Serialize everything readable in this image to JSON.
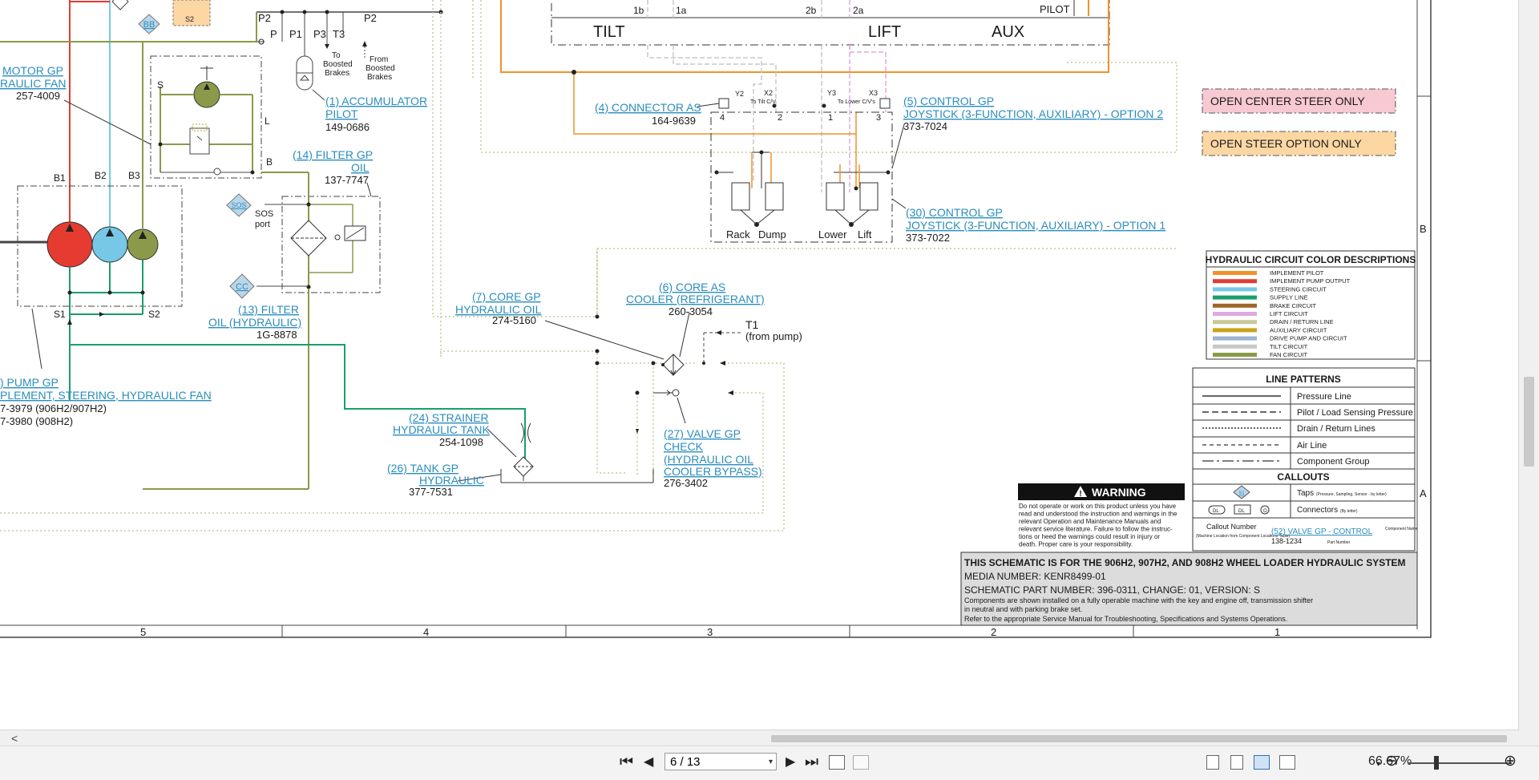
{
  "viewer": {
    "page_current": "6 / 13",
    "zoom": "66.67%",
    "zoom_out": "⊖",
    "zoom_in": "⊕",
    "hscroll_left": "<",
    "dropdown": "▾",
    "nav": {
      "first": "⏮",
      "prev": "◀",
      "next": "▶",
      "last": "⏭"
    }
  },
  "schematic": {
    "top_labels": {
      "p2a": "P2",
      "p": "P",
      "p1": "P1",
      "p3": "P3",
      "t3": "T3",
      "p2b": "P2",
      "bb": "BB",
      "s2box": "S2",
      "to_boosted": "To Boosted Brakes",
      "from_boosted": "From Boosted Brakes",
      "n1b": "1b",
      "n1a": "1a",
      "n2b": "2b",
      "n2a": "2a",
      "tilt": "TILT",
      "lift": "LIFT",
      "aux": "AUX",
      "pilot": "PILOT"
    },
    "callouts": {
      "motor_l1": "MOTOR GP",
      "motor_l2": "RAULIC FAN",
      "motor_pn": "257-4009",
      "acc_l1": "(1) ACCUMULATOR",
      "acc_l2": "PILOT",
      "acc_pn": "149-0686",
      "conn4_l1": "(4) CONNECTOR AS",
      "conn4_pn": "164-9639",
      "c5_l1": "(5) CONTROL GP",
      "c5_l2": "JOYSTICK (3-FUNCTION, AUXILIARY) - OPTION 2",
      "c5_pn": "373-7024",
      "c30_l1": "(30) CONTROL GP",
      "c30_l2": "JOYSTICK (3-FUNCTION, AUXILIARY) - OPTION 1",
      "c30_pn": "373-7022",
      "f14_l1": "(14) FILTER GP",
      "f14_l2": "OIL",
      "f14_pn": "137-7747",
      "f13_l1": "(13) FILTER",
      "f13_l2": "OIL (HYDRAULIC)",
      "f13_pn": "1G-8878",
      "c7_l1": "(7) CORE GP",
      "c7_l2": "HYDRAULIC OIL",
      "c7_pn": "274-5160",
      "c6_l1": "(6) CORE AS",
      "c6_l2": "COOLER (REFRIGERANT)",
      "c6_pn": "260-3054",
      "t1_l1": "T1",
      "t1_l2": "(from pump)",
      "pump_l1": ") PUMP GP",
      "pump_l2": "PLEMENT, STEERING, HYDRAULIC FAN",
      "pump_pn1": "7-3979 (906H2/907H2)",
      "pump_pn2": "7-3980 (908H2)",
      "s24_l1": "(24) STRAINER",
      "s24_l2": "HYDRAULIC TANK",
      "s24_pn": "254-1098",
      "t26_l1": "(26) TANK GP",
      "t26_l2": "HYDRAULIC",
      "t26_pn": "377-7531",
      "v27_l1": "(27) VALVE GP",
      "v27_l2": "CHECK",
      "v27_l3": "(HYDRAULIC OIL",
      "v27_l4": "COOLER BYPASS)",
      "v27_pn": "276-3402"
    },
    "small_labels": {
      "s": "S",
      "l": "L",
      "b": "B",
      "b1": "B1",
      "b2": "B2",
      "b3": "B3",
      "s1": "S1",
      "s2": "S2",
      "sos": "SOS",
      "sos_port1": "SOS",
      "sos_port2": "port",
      "cc": "CC",
      "y2": "Y2",
      "x2": "X2",
      "y3": "Y3",
      "x3": "X3",
      "to_tilt": "To Tilt C/V",
      "to_lower": "To Lower C/V's",
      "pin4": "4",
      "pin2": "2",
      "pin1": "1",
      "pin3": "3",
      "rack": "Rack",
      "dump": "Dump",
      "lower": "Lower",
      "lift2": "Lift"
    },
    "legend_boxes": {
      "open_center": "OPEN CENTER STEER ONLY",
      "open_steer": "OPEN STEER OPTION ONLY"
    },
    "colors": {
      "title": "HYDRAULIC CIRCUIT COLOR DESCRIPTIONS",
      "items": [
        {
          "label": "IMPLEMENT PILOT",
          "color": "#f0922b"
        },
        {
          "label": "IMPLEMENT PUMP OUTPUT",
          "color": "#e53b30"
        },
        {
          "label": "STEERING CIRCUIT",
          "color": "#76c8e6"
        },
        {
          "label": "SUPPLY LINE",
          "color": "#1a9e6a"
        },
        {
          "label": "BRAKE CIRCUIT",
          "color": "#a0652a"
        },
        {
          "label": "LIFT CIRCUIT",
          "color": "#e0a8e0"
        },
        {
          "label": "DRAIN / RETURN LINE",
          "color": "#c9c99a"
        },
        {
          "label": "AUXILIARY CIRCUIT",
          "color": "#c9a31a"
        },
        {
          "label": "DRIVE PUMP AND CIRCUIT",
          "color": "#9cb3d4"
        },
        {
          "label": "TILT CIRCUIT",
          "color": "#c8c8c8"
        },
        {
          "label": "FAN CIRCUIT",
          "color": "#8a9a4a"
        }
      ]
    },
    "patterns": {
      "title": "LINE PATTERNS",
      "items": [
        "Pressure Line",
        "Pilot / Load Sensing Pressure",
        "Drain / Return Lines",
        "Air Line",
        "Component Group"
      ],
      "callouts_title": "CALLOUTS",
      "taps": "Taps",
      "taps_note": "(Pressure, Sampling, Sensor - by letter)",
      "connectors": "Connectors",
      "connectors_note": "(By letter)",
      "conn_dl1": "DL",
      "conn_dl2": "DL",
      "conn_o": "O",
      "tap_sym": "S1",
      "example_callout": "Callout Number",
      "example_note": "(Machine Location from Component Locations Table)",
      "example_link": "(52) VALVE GP - CONTROL",
      "example_pn": "138-1234",
      "example_component": "Component Name",
      "example_partnum": "Part Number"
    },
    "warning": {
      "title": "WARNING",
      "lines": [
        "Do not operate or work on this product unless you have",
        "read and understood the instruction and warnings in the",
        "relevant Operation and Maintenance Manuals and",
        "relevant service literature. Failure to follow the instruc-",
        "tions or heed the warnings could result in injury or",
        "death. Proper care is your responsibility."
      ]
    },
    "titleblock": {
      "l1": "THIS SCHEMATIC IS FOR THE 906H2, 907H2, AND 908H2 WHEEL LOADER HYDRAULIC SYSTEM",
      "l2": "MEDIA NUMBER: KENR8499-01",
      "l3": "SCHEMATIC PART NUMBER: 396-0311, CHANGE: 01, VERSION: S",
      "l4": "Components are shown installed on a fully operable machine with the key and engine off, transmission shifter",
      "l5": "in neutral and with parking brake set.",
      "l6": "Refer to the appropriate Service Manual for Troubleshooting, Specifications and Systems Operations."
    },
    "grid": {
      "cols": [
        "5",
        "4",
        "3",
        "2",
        "1"
      ],
      "row_b": "B",
      "row_a": "A"
    }
  }
}
